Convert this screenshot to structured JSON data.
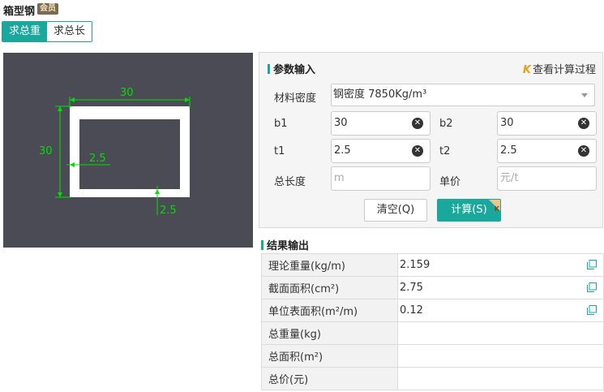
{
  "header": {
    "title": "箱型钢",
    "vip_badge": "会员"
  },
  "tabs": [
    {
      "label": "求总重",
      "active": true
    },
    {
      "label": "求总长",
      "active": false
    }
  ],
  "diagram": {
    "dim_top": "30",
    "dim_left": "30",
    "dim_t1": "2.5",
    "dim_t2": "2.5",
    "line_color": "#00e000",
    "shape_color": "#ffffff",
    "background": "#4a4b54"
  },
  "params": {
    "title": "参数输入",
    "view_process": "查看计算过程",
    "material_label": "材料密度",
    "material_value": "钢密度 7850Kg/m³",
    "b1_label": "b1",
    "b1_value": "30",
    "b2_label": "b2",
    "b2_value": "30",
    "t1_label": "t1",
    "t1_value": "2.5",
    "t2_label": "t2",
    "t2_value": "2.5",
    "length_label": "总长度",
    "length_placeholder": "m",
    "price_label": "单价",
    "price_placeholder": "元/t",
    "clear_button": "清空(Q)",
    "calc_button": "计算(S)"
  },
  "results": {
    "title": "结果输出",
    "rows": [
      {
        "label": "理论重量(kg/m)",
        "value": "2.159",
        "copy": true
      },
      {
        "label": "截面面积(cm²)",
        "value": "2.75",
        "copy": true
      },
      {
        "label": "单位表面积(m²/m)",
        "value": "0.12",
        "copy": true
      },
      {
        "label": "总重量(kg)",
        "value": "",
        "copy": false
      },
      {
        "label": "总面积(m²)",
        "value": "",
        "copy": false
      },
      {
        "label": "总价(元)",
        "value": "",
        "copy": false
      }
    ]
  },
  "colors": {
    "accent": "#1aa89c",
    "vip_gold": "#e4a11b"
  }
}
